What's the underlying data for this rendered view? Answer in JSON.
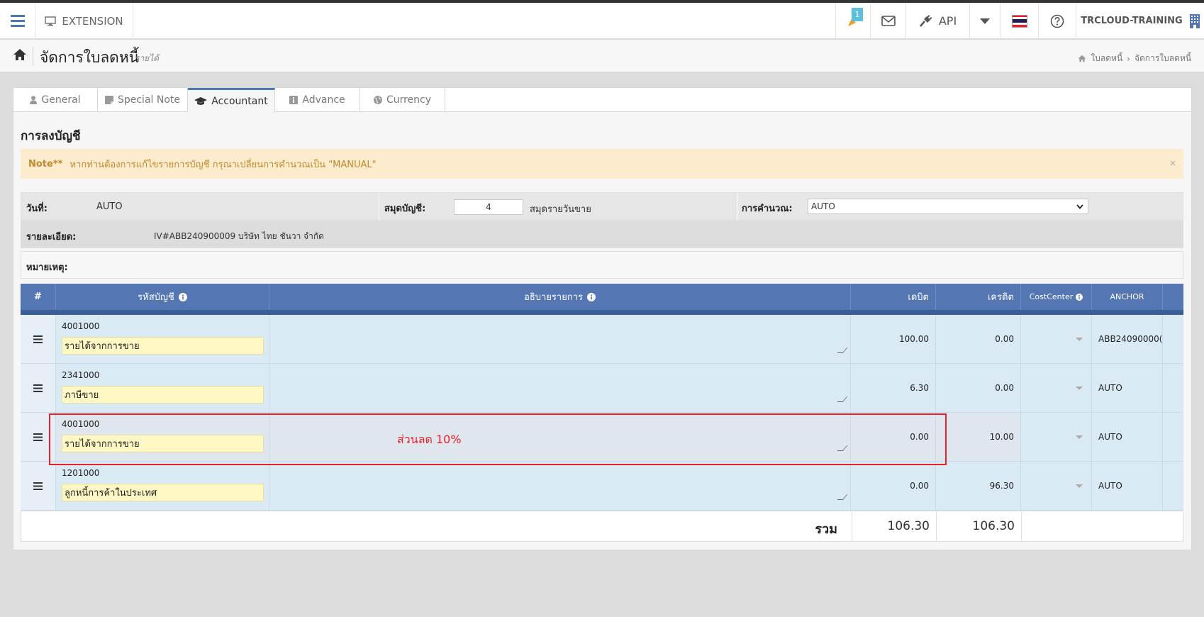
{
  "topbar": {
    "extension_label": "EXTENSION",
    "notification_count": "1",
    "api_label": "API",
    "user_name": "TRCLOUD-TRAINING",
    "flag_colors": [
      "#ed1c24",
      "#ffffff",
      "#241d4f",
      "#ffffff",
      "#ed1c24"
    ]
  },
  "page": {
    "title": "จัดการใบลดหนี้",
    "subtitle": "รายได้",
    "breadcrumb": [
      "ใบลดหนี้",
      "จัดการใบลดหนี้"
    ]
  },
  "tabs": [
    {
      "label": "General",
      "icon": "user-icon"
    },
    {
      "label": "Special Note",
      "icon": "note-icon"
    },
    {
      "label": "Accountant",
      "icon": "graduation-cap-icon",
      "active": true
    },
    {
      "label": "Advance",
      "icon": "info-icon"
    },
    {
      "label": "Currency",
      "icon": "globe-icon"
    }
  ],
  "section_title": "การลงบัญชี",
  "note": {
    "prefix": "Note**",
    "text": "หากท่านต้องการแก้ไขรายการบัญชี กรุณาเปลี่ยนการคำนวณเป็น \"MANUAL\"",
    "close": "×"
  },
  "info": {
    "date_label": "วันที่:",
    "date_value": "AUTO",
    "journal_label": "สมุดบัญชี:",
    "journal_number": "4",
    "journal_name": "สมุดรายวันขาย",
    "calc_label": "การคำนวณ:",
    "calc_value": "AUTO",
    "detail_label": "รายละเอียด:",
    "detail_value": "IV#ABB240900009  บริษัท ไทย ชันวา จำกัด",
    "remark_label": "หมายเหตุ:"
  },
  "grid": {
    "headers": {
      "index": "#",
      "account": "รหัสบัญชี",
      "description": "อธิบายรายการ",
      "debit": "เดบิต",
      "credit": "เครดิต",
      "costcenter": "CostCenter",
      "anchor": "ANCHOR"
    },
    "rows": [
      {
        "code": "4001000",
        "name": "รายได้จากการขาย",
        "desc": "",
        "debit": "100.00",
        "credit": "0.00",
        "anchor": "ABB24090000("
      },
      {
        "code": "2341000",
        "name": "ภาษีขาย",
        "desc": "",
        "debit": "6.30",
        "credit": "0.00",
        "anchor": "AUTO"
      },
      {
        "code": "4001000",
        "name": "รายได้จากการขาย",
        "desc": "",
        "debit": "0.00",
        "credit": "10.00",
        "anchor": "AUTO"
      },
      {
        "code": "1201000",
        "name": "ลูกหนี้การค้าในประเทศ",
        "desc": "",
        "debit": "0.00",
        "credit": "96.30",
        "anchor": "AUTO"
      }
    ],
    "total_label": "รวม",
    "total_debit": "106.30",
    "total_credit": "106.30"
  },
  "annotation": {
    "text": "ส่วนลด 10%",
    "color": "#e8202a"
  }
}
